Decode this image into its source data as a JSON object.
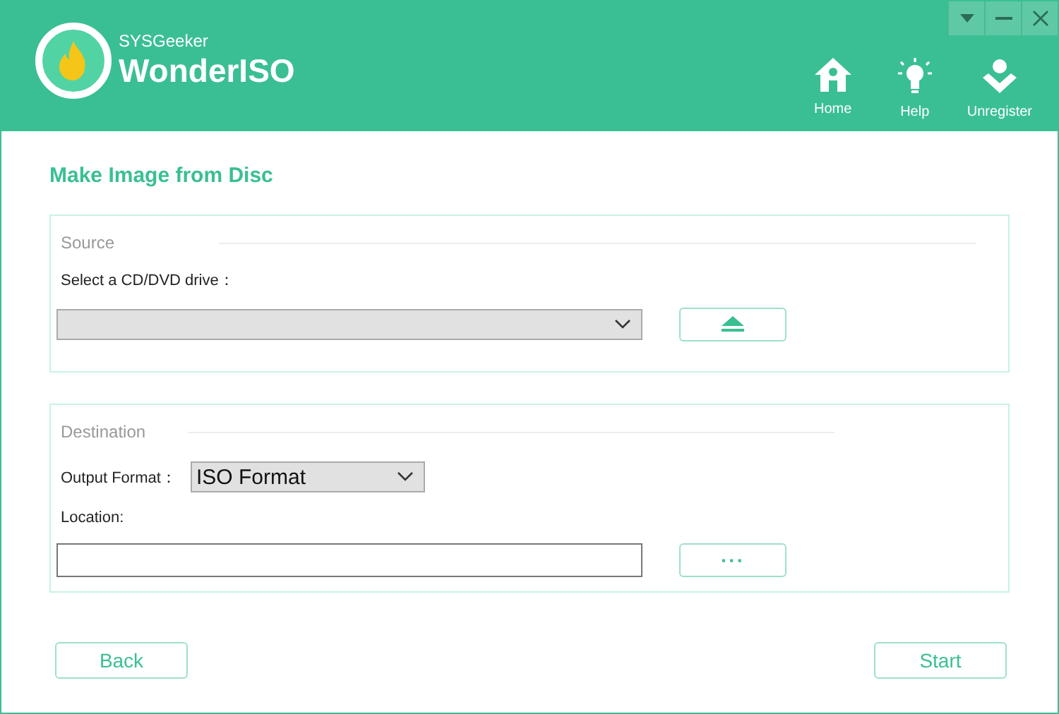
{
  "brand": {
    "company": "SYSGeeker",
    "product": "WonderISO"
  },
  "nav": [
    {
      "kind": "home",
      "label": "Home"
    },
    {
      "kind": "help",
      "label": "Help"
    },
    {
      "kind": "user",
      "label": "Unregister"
    }
  ],
  "page_title": "Make Image from Disc",
  "source": {
    "legend": "Source",
    "drive_label": "Select a CD/DVD drive："
  },
  "destination": {
    "legend": "Destination",
    "format_label": "Output Format：",
    "format_value": "ISO Format",
    "location_label": "Location:",
    "browse_label": "···"
  },
  "footer": {
    "back": "Back",
    "start": "Start"
  }
}
